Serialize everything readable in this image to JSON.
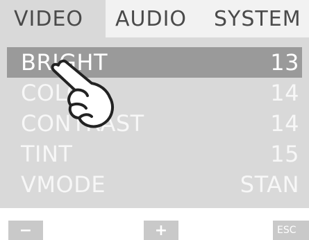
{
  "tabs": [
    {
      "label": "VIDEO",
      "active": true
    },
    {
      "label": "AUDIO",
      "active": false
    },
    {
      "label": "SYSTEM",
      "active": false
    }
  ],
  "menu": {
    "items": [
      {
        "label": "BRIGHT",
        "value": "13",
        "selected": true
      },
      {
        "label": "COLOR",
        "value": "14",
        "selected": false
      },
      {
        "label": "CONTRAST",
        "value": "14",
        "selected": false
      },
      {
        "label": "TINT",
        "value": "15",
        "selected": false
      },
      {
        "label": "VMODE",
        "value": "STAN",
        "selected": false
      }
    ]
  },
  "pointer": {
    "icon": "hand-pointer-icon"
  },
  "buttons": {
    "minus_label": "−",
    "plus_label": "+",
    "esc_label": "ESC"
  },
  "colors": {
    "panel_bg": "#d9d9d9",
    "selected_row": "#9a9a9a",
    "button_bg": "#c9c9c9"
  }
}
